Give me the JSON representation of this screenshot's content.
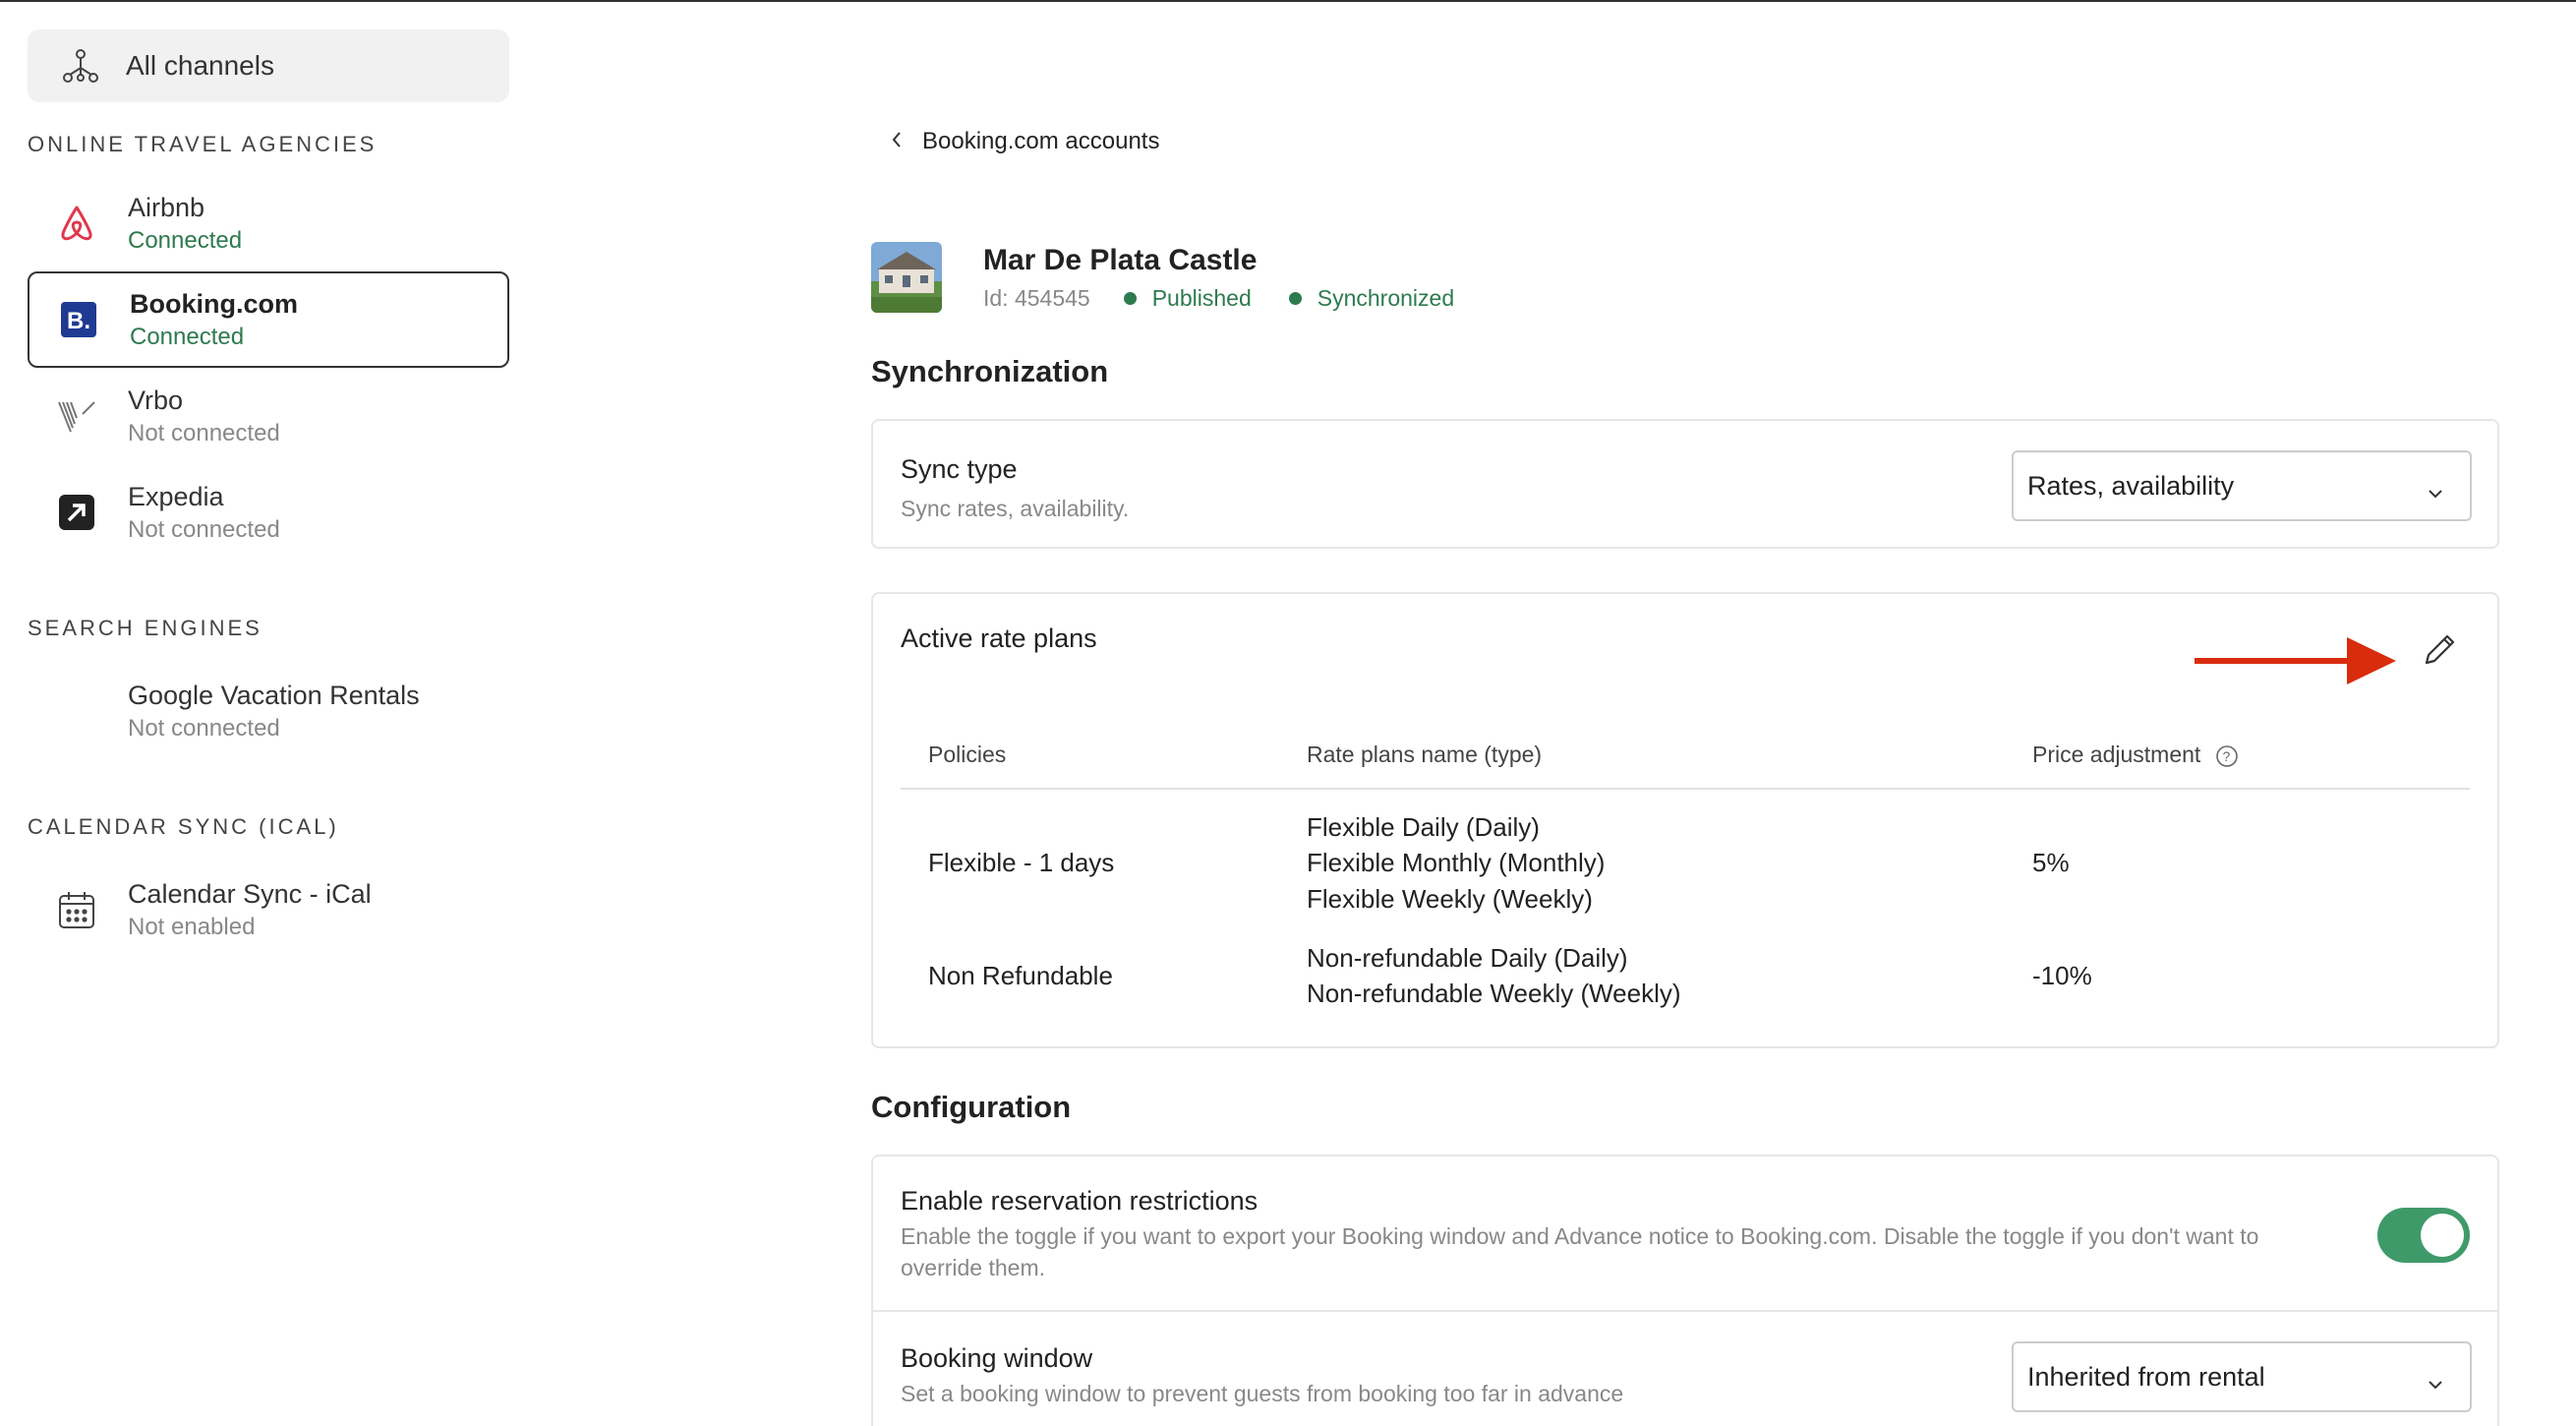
{
  "sidebar": {
    "all_channels": "All channels",
    "sections": {
      "ota": "ONLINE TRAVEL AGENCIES",
      "search": "SEARCH ENGINES",
      "ical": "CALENDAR SYNC (ICAL)"
    },
    "channels": [
      {
        "name": "Airbnb",
        "status": "Connected",
        "icon": "airbnb-icon"
      },
      {
        "name": "Booking.com",
        "status": "Connected",
        "icon": "booking-icon"
      },
      {
        "name": "Vrbo",
        "status": "Not connected",
        "icon": "vrbo-icon"
      },
      {
        "name": "Expedia",
        "status": "Not connected",
        "icon": "expedia-icon"
      },
      {
        "name": "Google Vacation Rentals",
        "status": "Not connected",
        "icon": "google-icon"
      },
      {
        "name": "Calendar Sync - iCal",
        "status": "Not enabled",
        "icon": "calendar-icon"
      }
    ]
  },
  "breadcrumb": "Booking.com accounts",
  "property": {
    "title": "Mar De Plata Castle",
    "id": "Id: 454545",
    "published": "Published",
    "synchronized": "Synchronized"
  },
  "sync": {
    "heading": "Synchronization",
    "type_label": "Sync type",
    "type_sub": "Sync rates, availability.",
    "type_value": "Rates, availability"
  },
  "rate_plans": {
    "title": "Active rate plans",
    "headers": [
      "Policies",
      "Rate plans name (type)",
      "Price adjustment"
    ],
    "rows": [
      {
        "policy": "Flexible - 1 days",
        "plans": [
          "Flexible Daily (Daily)",
          "Flexible Monthly (Monthly)",
          "Flexible Weekly (Weekly)"
        ],
        "adjustment": "5%"
      },
      {
        "policy": "Non Refundable",
        "plans": [
          "Non-refundable Daily (Daily)",
          "Non-refundable Weekly (Weekly)"
        ],
        "adjustment": "-10%"
      }
    ]
  },
  "config": {
    "heading": "Configuration",
    "restrictions_label": "Enable reservation restrictions",
    "restrictions_sub": "Enable the toggle if you want to export your Booking window and Advance notice to Booking.com. Disable the toggle if you don't want to override them.",
    "restrictions_on": true,
    "window_label": "Booking window",
    "window_sub": "Set a booking window to prevent guests from booking too far in advance",
    "window_value": "Inherited from rental"
  },
  "colors": {
    "accent_green": "#2e7a4f",
    "toggle_green": "#3f9a6a",
    "arrow_red": "#d82c0d",
    "booking_blue": "#1f3a93",
    "airbnb_red": "#e0384b"
  }
}
